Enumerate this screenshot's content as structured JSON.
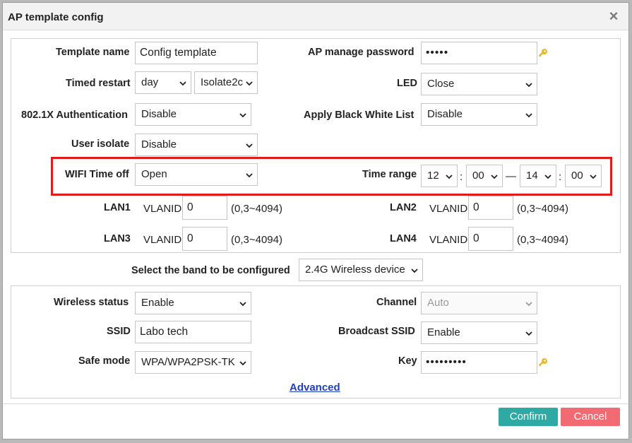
{
  "window": {
    "title": "AP template config",
    "close_label": "×"
  },
  "template": {
    "name_label": "Template name",
    "name_value": "Config template",
    "password_label": "AP manage password",
    "password_value": "•••••",
    "timed_restart_label": "Timed restart",
    "timed_restart_unit": "day",
    "timed_restart_time": "Isolate2c",
    "led_label": "LED",
    "led_value": "Close",
    "auth_label": "802.1X Authentication",
    "auth_value": "Disable",
    "blacklist_label": "Apply Black White List",
    "blacklist_value": "Disable",
    "user_isolate_label": "User isolate",
    "user_isolate_value": "Disable",
    "wifi_time_off_label": "WIFI Time off",
    "wifi_time_off_value": "Open",
    "time_range_label": "Time range",
    "time_start_hour": "12",
    "time_start_min": "00",
    "time_dash": "—",
    "time_end_hour": "14",
    "time_end_min": "00",
    "time_colon": ":",
    "lans": [
      {
        "label": "LAN1",
        "vlan_label": "VLANID",
        "value": "0",
        "range": "(0,3~4094)"
      },
      {
        "label": "LAN2",
        "vlan_label": "VLANID",
        "value": "0",
        "range": "(0,3~4094)"
      },
      {
        "label": "LAN3",
        "vlan_label": "VLANID",
        "value": "0",
        "range": "(0,3~4094)"
      },
      {
        "label": "LAN4",
        "vlan_label": "VLANID",
        "value": "0",
        "range": "(0,3~4094)"
      }
    ]
  },
  "band": {
    "label": "Select the band to be configured",
    "value": "2.4G Wireless device"
  },
  "wireless": {
    "status_label": "Wireless status",
    "status_value": "Enable",
    "channel_label": "Channel",
    "channel_value": "Auto",
    "ssid_label": "SSID",
    "ssid_value": "Labo tech",
    "broadcast_label": "Broadcast SSID",
    "broadcast_value": "Enable",
    "safe_mode_label": "Safe mode",
    "safe_mode_value": "WPA/WPA2PSK-TK",
    "key_label": "Key",
    "key_value": "•••••••••",
    "advanced_label": "Advanced"
  },
  "footer": {
    "confirm_label": "Confirm",
    "cancel_label": "Cancel"
  },
  "colors": {
    "highlight": "#e11a1a",
    "confirm": "#2fa9a4",
    "cancel": "#f26a72",
    "link": "#1f3fbf",
    "key_icon": "#e8b923"
  },
  "icons": {
    "key": "key-icon",
    "dropdown": "chevron-down-icon",
    "close": "close-icon"
  }
}
